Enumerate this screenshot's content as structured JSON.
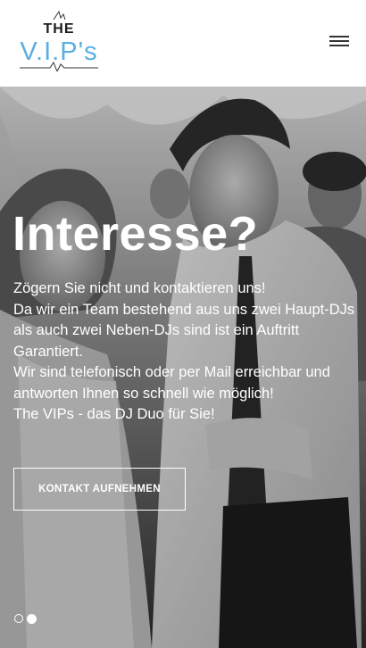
{
  "header": {
    "logo": {
      "line1": "THE",
      "line2": "V.I.P's"
    },
    "menu_icon": "hamburger-menu-icon"
  },
  "hero": {
    "title": "Interesse?",
    "text_lines": [
      "Zögern Sie nicht und kontaktieren uns!",
      "Da wir ein Team bestehend aus uns zwei Haupt-DJs",
      "als auch zwei Neben-DJs sind ist ein Auftritt",
      "Garantiert.",
      "Wir sind telefonisch oder per Mail erreichbar und",
      "antworten Ihnen so schnell wie möglich!",
      "The VIPs - das DJ Duo für Sie!"
    ],
    "cta_label": "KONTAKT AUFNEHMEN",
    "slider": {
      "slide_count": 2,
      "active_slide": 2
    }
  },
  "colors": {
    "logo_accent": "#5aaee0",
    "logo_dark": "#1c1c1c",
    "hero_text": "#ffffff"
  }
}
